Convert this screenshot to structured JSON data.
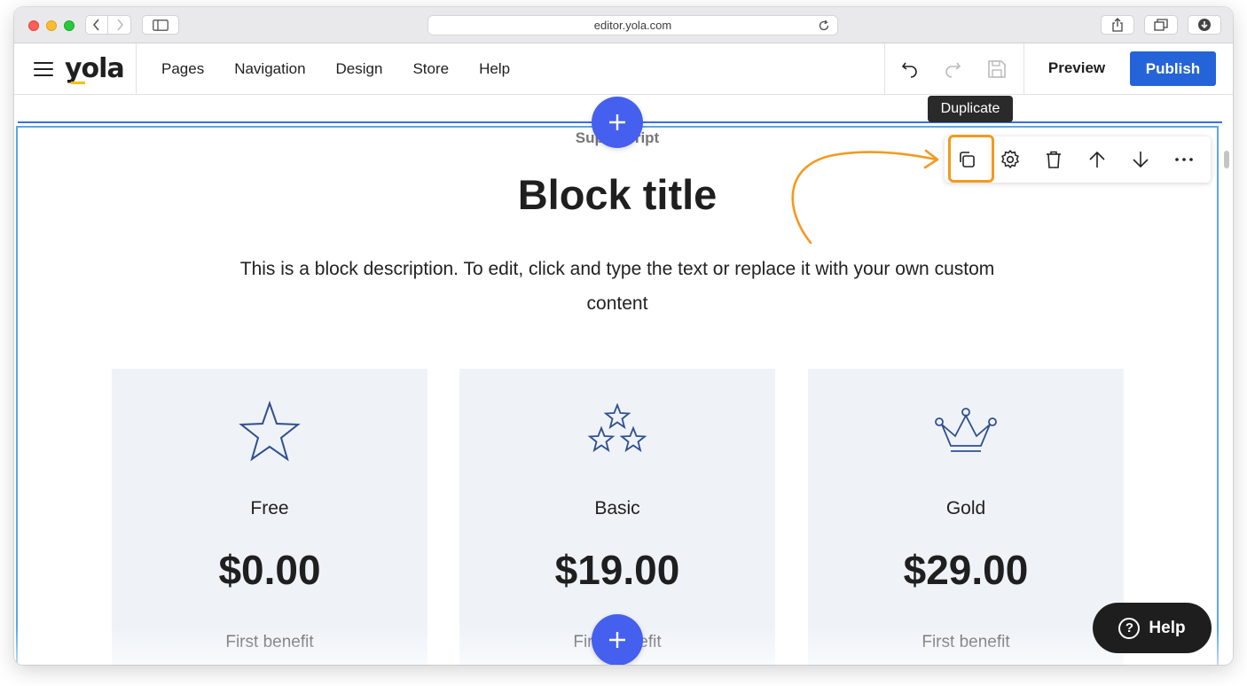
{
  "browser": {
    "url": "editor.yola.com"
  },
  "topbar": {
    "logo": "yola",
    "menu": [
      "Pages",
      "Navigation",
      "Design",
      "Store",
      "Help"
    ],
    "preview_label": "Preview",
    "publish_label": "Publish"
  },
  "tooltip": "Duplicate",
  "block": {
    "superscript": "Superscript",
    "title": "Block title",
    "description": "This is a block description. To edit, click and type the text or replace it with your own custom content"
  },
  "cards": [
    {
      "name": "Free",
      "price": "$0.00",
      "benefit": "First benefit",
      "icon": "star-icon"
    },
    {
      "name": "Basic",
      "price": "$19.00",
      "benefit": "First benefit",
      "icon": "three-stars-icon"
    },
    {
      "name": "Gold",
      "price": "$29.00",
      "benefit": "First benefit",
      "icon": "crown-icon"
    }
  ],
  "help_button": {
    "label": "Help"
  },
  "colors": {
    "publish": "#2563d8",
    "add_button": "#4560ef",
    "highlight": "#f39a1e",
    "card_bg": "#eff3f8",
    "selection": "#5aa7e6"
  }
}
